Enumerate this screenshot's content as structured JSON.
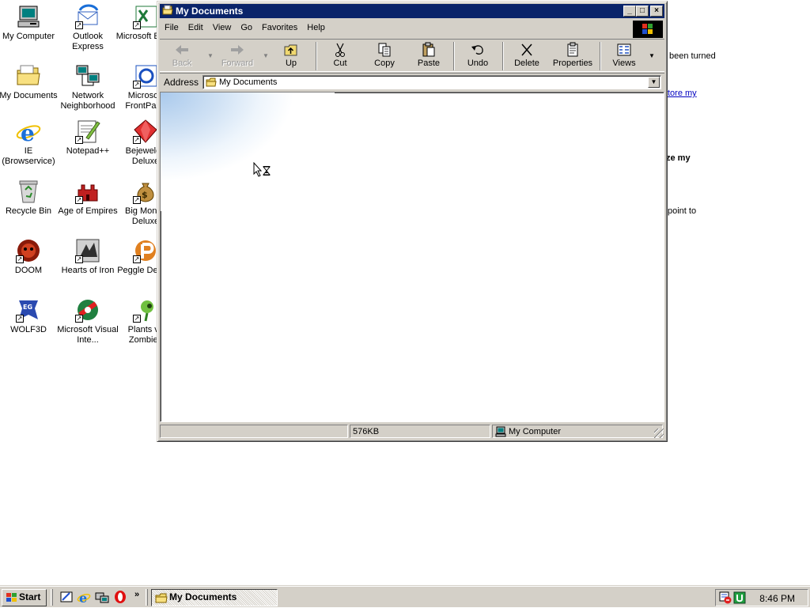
{
  "desktop": {
    "icons": [
      {
        "label": "My Computer"
      },
      {
        "label": "Outlook Express"
      },
      {
        "label": "Microsoft Excel"
      },
      {
        "label": "My Documents"
      },
      {
        "label": "Network Neighborhood"
      },
      {
        "label": "Microsoft FrontPage"
      },
      {
        "label": "IE (Browservice)"
      },
      {
        "label": "Notepad++"
      },
      {
        "label": "Bejeweled Deluxe"
      },
      {
        "label": "Recycle Bin"
      },
      {
        "label": "Age of Empires"
      },
      {
        "label": "Big Money Deluxe"
      },
      {
        "label": "DOOM"
      },
      {
        "label": "Hearts of Iron"
      },
      {
        "label": "Peggle Deluxe"
      },
      {
        "label": "WOLF3D"
      },
      {
        "label": "Microsoft Visual Inte..."
      },
      {
        "label": "Plants vs Zombies"
      }
    ],
    "background_fragments": [
      "been turned",
      "tore my",
      "ze my",
      "point to"
    ]
  },
  "window": {
    "title": "My Documents",
    "title_buttons": {
      "minimize": "_",
      "maximize": "□",
      "close": "×"
    },
    "menu": [
      "File",
      "Edit",
      "View",
      "Go",
      "Favorites",
      "Help"
    ],
    "toolbar": {
      "back": "Back",
      "forward": "Forward",
      "up": "Up",
      "cut": "Cut",
      "copy": "Copy",
      "paste": "Paste",
      "undo": "Undo",
      "delete": "Delete",
      "properties": "Properties",
      "views": "Views"
    },
    "address": {
      "label": "Address",
      "value": "My Documents"
    },
    "status": {
      "size": "576KB",
      "zone": "My Computer"
    }
  },
  "taskbar": {
    "start_label": "Start",
    "chevron": "»",
    "task_button": "My Documents",
    "clock": "8:46 PM"
  },
  "colors": {
    "titlebar": "#0a246a",
    "face": "#d4d0c8",
    "desktop": "#ffffff"
  }
}
